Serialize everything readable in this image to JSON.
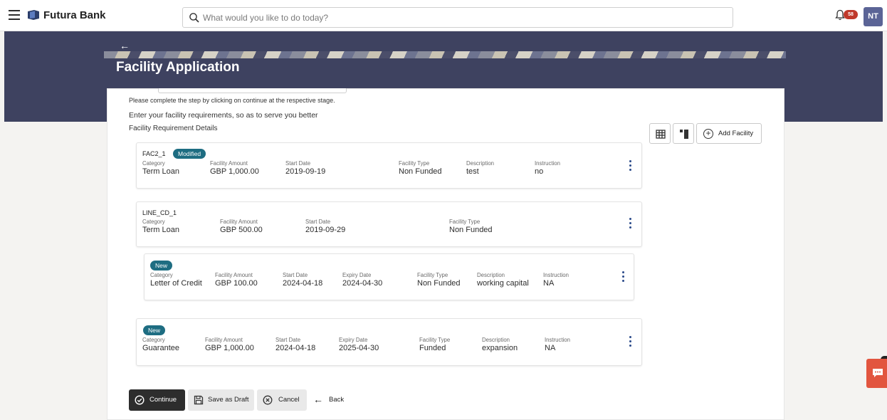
{
  "header": {
    "brand": "Futura Bank",
    "search_placeholder": "What would you like to do today?",
    "notification_count": "58",
    "user_initials": "NT"
  },
  "page": {
    "title": "Facility Application",
    "note": "Please complete the step by clicking on continue at the respective stage.",
    "intro": "Enter your facility requirements, so as to serve you better",
    "section_title": "Facility Requirement Details"
  },
  "toolbar": {
    "add_facility_label": "Add Facility"
  },
  "facilities": [
    {
      "name": "FAC2_1",
      "badge": "Modified",
      "fields": [
        {
          "label": "Category",
          "value": "Term Loan"
        },
        {
          "label": "Facility Amount",
          "value": "GBP 1,000.00"
        },
        {
          "label": "Start Date",
          "value": "2019-09-19"
        },
        {
          "label": "Facility Type",
          "value": "Non Funded"
        },
        {
          "label": "Description",
          "value": "test"
        },
        {
          "label": "Instruction",
          "value": "no"
        }
      ]
    },
    {
      "name": "LINE_CD_1",
      "badge": "",
      "fields": [
        {
          "label": "Category",
          "value": "Term Loan"
        },
        {
          "label": "Facility Amount",
          "value": "GBP 500.00"
        },
        {
          "label": "Start Date",
          "value": "2019-09-29"
        },
        {
          "label": "Facility Type",
          "value": "Non Funded"
        }
      ]
    },
    {
      "name": "",
      "badge": "New",
      "fields": [
        {
          "label": "Category",
          "value": "Letter of Credit"
        },
        {
          "label": "Facility Amount",
          "value": "GBP 100.00"
        },
        {
          "label": "Start Date",
          "value": "2024-04-18"
        },
        {
          "label": "Expiry Date",
          "value": "2024-04-30"
        },
        {
          "label": "Facility Type",
          "value": "Non Funded"
        },
        {
          "label": "Description",
          "value": "working capital"
        },
        {
          "label": "Instruction",
          "value": "NA"
        }
      ]
    },
    {
      "name": "",
      "badge": "New",
      "fields": [
        {
          "label": "Category",
          "value": "Guarantee"
        },
        {
          "label": "Facility Amount",
          "value": "GBP 1,000.00"
        },
        {
          "label": "Start Date",
          "value": "2024-04-18"
        },
        {
          "label": "Expiry Date",
          "value": "2025-04-30"
        },
        {
          "label": "Facility Type",
          "value": "Funded"
        },
        {
          "label": "Description",
          "value": "expansion"
        },
        {
          "label": "Instruction",
          "value": "NA"
        }
      ]
    }
  ],
  "actions": {
    "continue": "Continue",
    "save_draft": "Save as Draft",
    "cancel": "Cancel",
    "back": "Back"
  },
  "icons": {
    "menu": "hamburger-icon",
    "brand": "bank-logo-icon",
    "search": "search-icon",
    "notifications": "bell-icon",
    "table_view": "table-view-icon",
    "card_view": "card-view-icon",
    "add": "add-circle-icon",
    "row_menu": "kebab-menu-icon",
    "chat": "chat-icon"
  },
  "colors": {
    "band": "#3e4260",
    "badge": "#1e6d82",
    "primary_button": "#2d2d2d",
    "notification": "#c0392b",
    "avatar": "#5b6496",
    "chat": "#e2553f"
  }
}
